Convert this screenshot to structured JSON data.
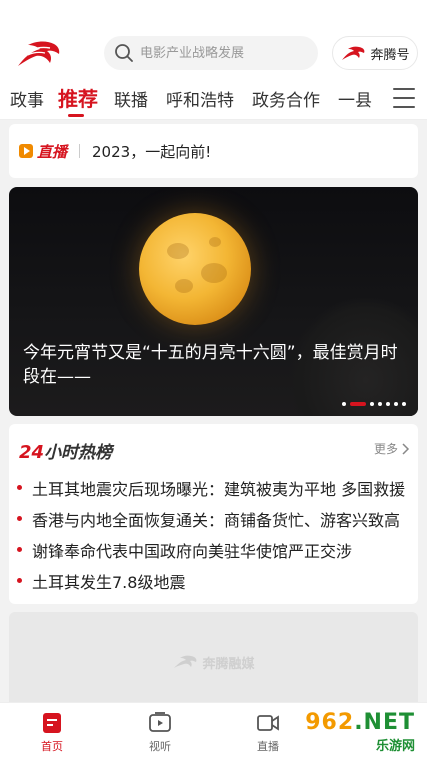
{
  "header": {
    "search_placeholder": "电影产业战略发展",
    "brand_label": "奔腾号"
  },
  "tabs": [
    {
      "label": "政事"
    },
    {
      "label": "推荐"
    },
    {
      "label": "联播"
    },
    {
      "label": "呼和浩特"
    },
    {
      "label": "政务合作"
    },
    {
      "label": "一县"
    }
  ],
  "live": {
    "badge": "直播",
    "text": "2023，一起向前!"
  },
  "banner": {
    "title": "今年元宵节又是“十五的月亮十六圆”，最佳赏月时段在——",
    "page_count": 7,
    "active_page": 2
  },
  "hot": {
    "header_num": "24",
    "header_text": "小时热榜",
    "more": "更多",
    "items": [
      "土耳其地震灾后现场曝光：建筑被夷为平地 多国救援",
      "香港与内地全面恢复通关：商铺备货忙、游客兴致高",
      "谢锋奉命代表中国政府向美驻华使馆严正交涉",
      "土耳其发生7.8级地震"
    ]
  },
  "placeholder": {
    "watermark": "奔腾融媒"
  },
  "bottom_nav": [
    {
      "label": "首页"
    },
    {
      "label": "视听"
    },
    {
      "label": "直播"
    }
  ],
  "site_badge": {
    "main_left": "962",
    "main_right": ".NET",
    "sub": "乐游网"
  },
  "colors": {
    "accent": "#d6141f",
    "live_icon": "#f08a00"
  }
}
